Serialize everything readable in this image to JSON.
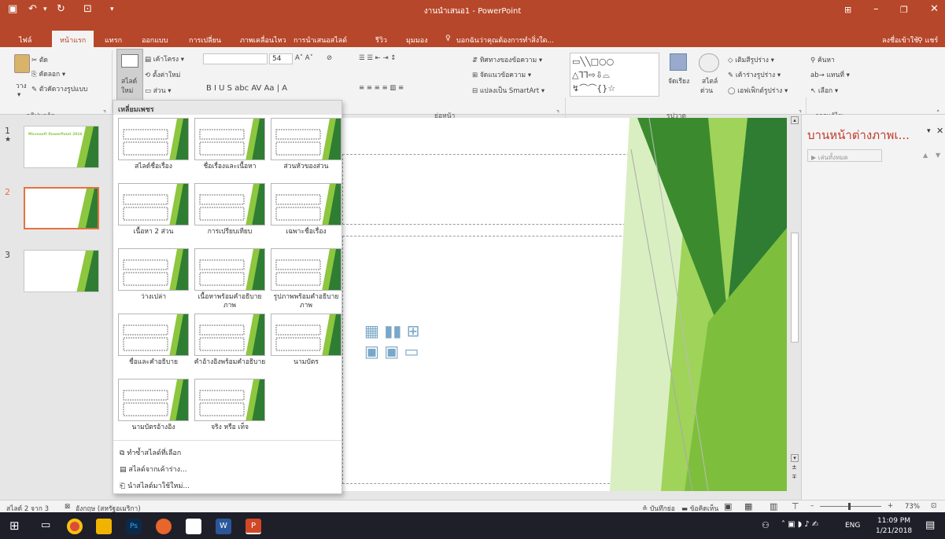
{
  "window": {
    "title": "งานนำเสนอ1 - PowerPoint",
    "colors": {
      "brand": "#b7472a",
      "accent": "#e6713f",
      "green": "#8dc63f"
    }
  },
  "quick_access": [
    "save-icon",
    "undo-icon",
    "redo-icon",
    "present-icon",
    "customize-icon"
  ],
  "tabs": [
    {
      "label": "ไฟล์"
    },
    {
      "label": "หน้าแรก",
      "active": true
    },
    {
      "label": "แทรก"
    },
    {
      "label": "ออกแบบ"
    },
    {
      "label": "การเปลี่ยน"
    },
    {
      "label": "ภาพเคลื่อนไหว"
    },
    {
      "label": "การนำเสนอสไลด์"
    },
    {
      "label": "รีวิว"
    },
    {
      "label": "มุมมอง"
    }
  ],
  "tell_me": "บอกฉันว่าคุณต้องการทำสิ่งใด...",
  "account": {
    "signin": "ลงชื่อเข้าใช้",
    "share": "แชร์"
  },
  "ribbon": {
    "clipboard": {
      "paste": "วาง",
      "cut": "ตัด",
      "copy": "คัดลอก",
      "format_painter": "ตัวคัดวางรูปแบบ",
      "group": "คลิปบอร์ด"
    },
    "slides": {
      "new_slide": "สไลด์",
      "new_slide2": "ใหม่",
      "layout": "เค้าโครง",
      "reset": "ตั้งค่าใหม่",
      "section": "ส่วน"
    },
    "font": {
      "size": "54"
    },
    "paragraph": {
      "text_direction": "ทิศทางของข้อความ",
      "align_text": "จัดแนวข้อความ",
      "smartart": "แปลงเป็น SmartArt",
      "group": "ย่อหน้า"
    },
    "drawing": {
      "arrange": "จัดเรียง",
      "quick_styles": "สไตล์",
      "quick_styles2": "ด่วน",
      "shape_fill": "เติมสีรูปร่าง",
      "shape_outline": "เค้าร่างรูปร่าง",
      "shape_effects": "เอฟเฟ็กต์รูปร่าง",
      "group": "รูปวาด"
    },
    "editing": {
      "find": "ค้นหา",
      "replace": "แทนที่",
      "select": "เลือก",
      "group": "การแก้ไข"
    }
  },
  "thumbnails": [
    {
      "num": "1",
      "star": "★",
      "title": "Microsoft PowerPoint 2016"
    },
    {
      "num": "2"
    },
    {
      "num": "3"
    }
  ],
  "layout_menu": {
    "header": "เหลี่ยมเพชร",
    "layouts": [
      {
        "label": "สไลด์ชื่อเรื่อง"
      },
      {
        "label": "ชื่อเรื่องและเนื้อหา"
      },
      {
        "label": "ส่วนหัวของส่วน"
      },
      {
        "label": "เนื้อหา 2 ส่วน"
      },
      {
        "label": "การเปรียบเทียบ"
      },
      {
        "label": "เฉพาะชื่อเรื่อง"
      },
      {
        "label": "ว่างเปล่า"
      },
      {
        "label": "เนื้อหาพร้อมคำอธิบายภาพ"
      },
      {
        "label": "รูปภาพพร้อมคำอธิบายภาพ"
      },
      {
        "label": "ชื่อและคำอธิบาย"
      },
      {
        "label": "คำอ้างอิงพร้อมคำอธิบาย"
      },
      {
        "label": "นามบัตร"
      },
      {
        "label": "นามบัตรอ้างอิง"
      },
      {
        "label": "จริง หรือ เท็จ"
      }
    ],
    "actions": [
      {
        "label": "ทำซ้ำสไลด์ที่เลือก"
      },
      {
        "label": "สไลด์จากเค้าร่าง..."
      },
      {
        "label": "นำสไลด์มาใช้ใหม่..."
      }
    ]
  },
  "task_pane": {
    "title": "บานหน้าต่างภาพเ...",
    "play_all": "เล่นทั้งหมด"
  },
  "status": {
    "slide_count": "สไลด์ 2 จาก 3",
    "language": "อังกฤษ (สหรัฐอเมริกา)",
    "notes": "บันทึกย่อ",
    "comments": "ข้อคิดเห็น",
    "zoom": "73%"
  },
  "taskbar": {
    "time": "11:09 PM",
    "date": "1/21/2018",
    "lang": "ENG"
  }
}
